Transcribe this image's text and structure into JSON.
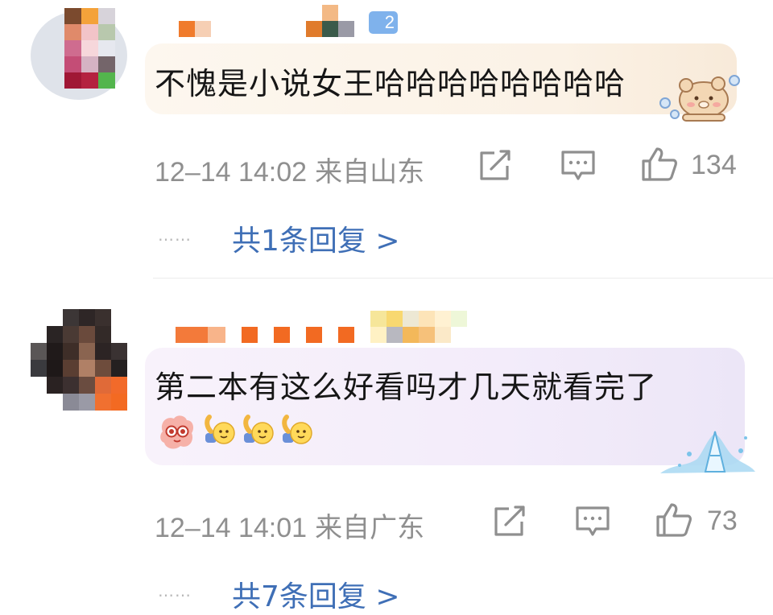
{
  "comments": [
    {
      "text": "不愧是小说女王哈哈哈哈哈哈哈哈",
      "time": "12–14 14:02",
      "location": "来自山东",
      "likes": "134",
      "reply_label": "共1条回复 >",
      "badge_level": "2"
    },
    {
      "text": "第二本有这么好看吗才几天就看完了",
      "time": "12–14 14:01",
      "location": "来自广东",
      "likes": "73",
      "reply_label": "共7条回复 >"
    }
  ],
  "ellipsis": "……",
  "colors": {
    "link": "#3f6fb6",
    "meta": "#8f8f8f",
    "bubble_1": "#fbf2e6",
    "bubble_2": "#f3ecfa"
  },
  "icons": [
    "share-icon",
    "comment-icon",
    "like-icon"
  ]
}
